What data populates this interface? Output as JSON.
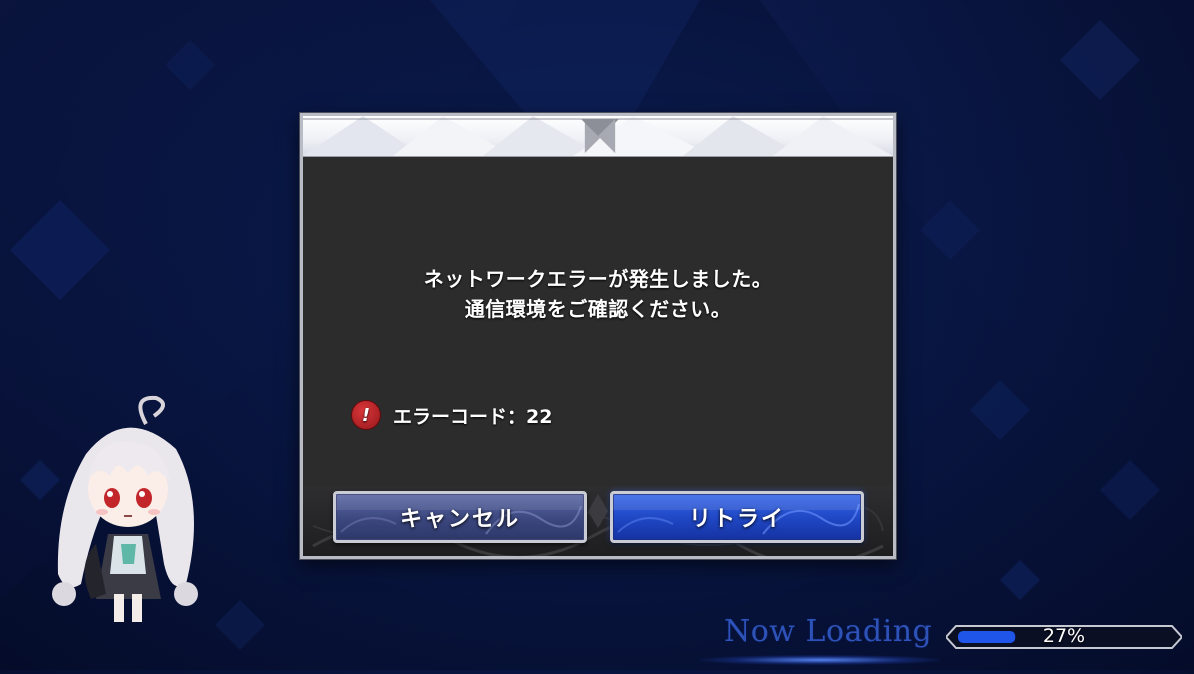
{
  "dialog": {
    "message_line1": "ネットワークエラーが発生しました。",
    "message_line2": "通信環境をご確認ください。",
    "error_icon": "!",
    "error_code_label": "エラーコード：22",
    "cancel_label": "キャンセル",
    "retry_label": "リトライ"
  },
  "loading": {
    "label": "Now Loading",
    "progress": 0.27,
    "progress_text": "27%"
  },
  "colors": {
    "background": "#081540",
    "dialog_body": "#2c2c2d",
    "cancel_button": "#3b477e",
    "retry_button": "#1f46c3",
    "error_icon": "#b02024",
    "loading_text": "#2d52b8",
    "progress_fill": "#1f55e8"
  },
  "icons": {
    "error": "exclamation-circle-icon",
    "corner": "ornament-corner-icon",
    "character": "chibi-character-illustration"
  }
}
